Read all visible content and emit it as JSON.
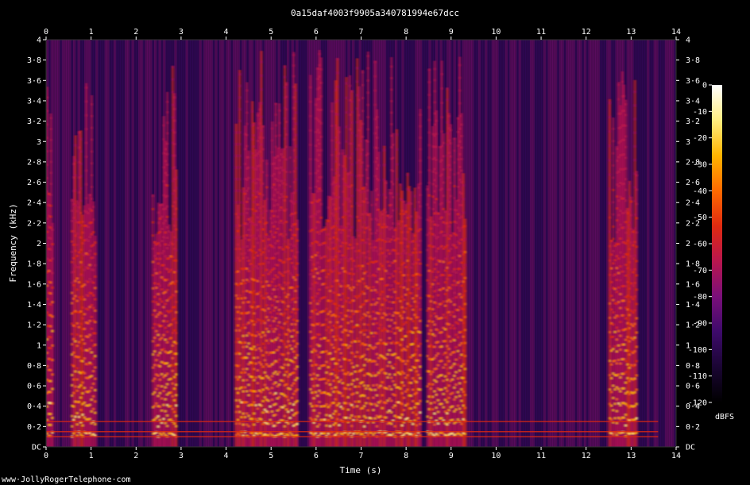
{
  "chart_data": {
    "type": "heatmap",
    "title": "0a15daf4003f9905a340781994e67dcc",
    "xlabel": "Time (s)",
    "ylabel": "Frequency (kHz)",
    "xlim": [
      0,
      14
    ],
    "ylim": [
      0,
      4
    ],
    "x_ticks": [
      "0",
      "1",
      "2",
      "3",
      "4",
      "5",
      "6",
      "7",
      "8",
      "9",
      "10",
      "11",
      "12",
      "13",
      "14"
    ],
    "y_ticks": [
      "DC",
      "0·2",
      "0·4",
      "0·6",
      "0·8",
      "1",
      "1·2",
      "1·4",
      "1·6",
      "1·8",
      "2",
      "2·2",
      "2·4",
      "2·6",
      "2·8",
      "3",
      "3·2",
      "3·4",
      "3·6",
      "3·8",
      "4"
    ],
    "colorbar": {
      "label": "dBFS",
      "range": [
        -120,
        0
      ],
      "ticks": [
        "0",
        "-10",
        "-20",
        "-30",
        "-40",
        "-50",
        "-60",
        "-70",
        "-80",
        "-90",
        "-100",
        "-110",
        "-120"
      ]
    },
    "colormap": [
      "#000000",
      "#1a0533",
      "#3d0a6b",
      "#7a0f7a",
      "#b8164e",
      "#e02a10",
      "#ff6a00",
      "#ffb400",
      "#ffee80",
      "#ffffff"
    ],
    "speech_segments_s": [
      [
        0.0,
        0.15
      ],
      [
        0.55,
        1.1
      ],
      [
        2.35,
        2.9
      ],
      [
        4.2,
        5.6
      ],
      [
        5.85,
        8.3
      ],
      [
        8.45,
        9.3
      ],
      [
        12.5,
        13.1
      ]
    ],
    "hum_lines_khz": [
      0.1,
      0.15,
      0.25
    ]
  },
  "watermark": "www·JollyRogerTelephone·com"
}
